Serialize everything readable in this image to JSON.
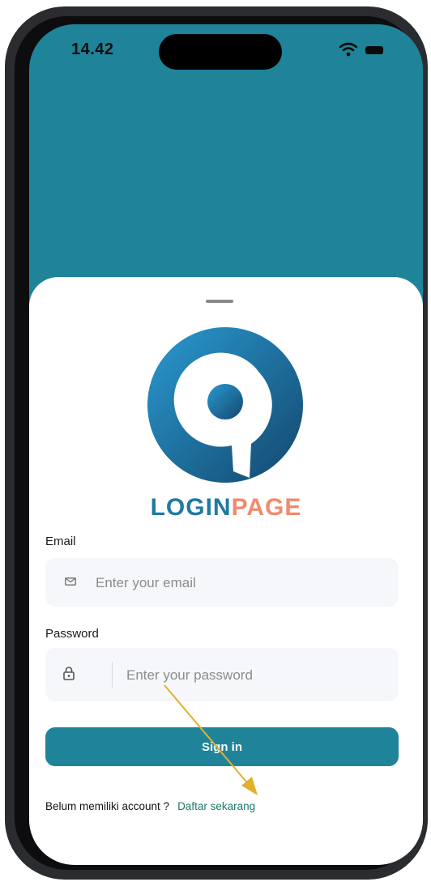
{
  "status_bar": {
    "time": "14.42"
  },
  "logo": {
    "word_part1": "LOGIN",
    "word_part2": "PAGE",
    "color_primary": "#1f7aa0",
    "color_secondary": "#f08a6e"
  },
  "form": {
    "email_label": "Email",
    "email_placeholder": "Enter your email",
    "password_label": "Password",
    "password_placeholder": "Enter your password",
    "signin_label": "Sign in"
  },
  "footer": {
    "prompt": "Belum memiliki account ?",
    "register_link": "Daftar sekarang"
  },
  "colors": {
    "header_bg": "#1f8399",
    "button_bg": "#1f8399",
    "link": "#1a7a66",
    "arrow": "#e0b22c"
  },
  "icons": [
    "wifi-icon",
    "battery-icon",
    "mail-icon",
    "lock-icon"
  ]
}
